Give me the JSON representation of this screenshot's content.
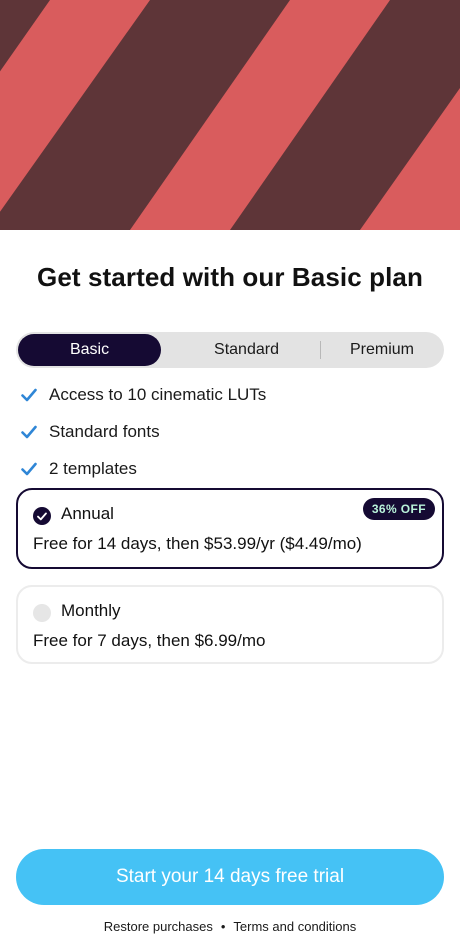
{
  "hero": {
    "colors": {
      "dark": "#5e3538",
      "stripe": "#d95c5d"
    }
  },
  "title": "Get started with our Basic plan",
  "tabs": [
    {
      "label": "Basic",
      "selected": true
    },
    {
      "label": "Standard",
      "selected": false
    },
    {
      "label": "Premium",
      "selected": false
    }
  ],
  "features": [
    {
      "text": "Access to 10 cinematic LUTs",
      "icon": "check-icon"
    },
    {
      "text": "Standard fonts",
      "icon": "check-icon"
    },
    {
      "text": "2 templates",
      "icon": "check-icon"
    }
  ],
  "plans": {
    "annual": {
      "name": "Annual",
      "description": "Free for 14 days, then $53.99/yr ($4.49/mo)",
      "badge": "36% OFF",
      "selected": true
    },
    "monthly": {
      "name": "Monthly",
      "description": "Free for 7 days, then $6.99/mo",
      "selected": false
    }
  },
  "cta": {
    "label": "Start your 14 days free trial"
  },
  "footer": {
    "restore": "Restore purchases",
    "separator": "•",
    "terms": "Terms and conditions"
  },
  "colors": {
    "accent": "#45c2f5",
    "dark": "#150a33",
    "check": "#2f86d6",
    "badge_text": "#b9f3da"
  }
}
